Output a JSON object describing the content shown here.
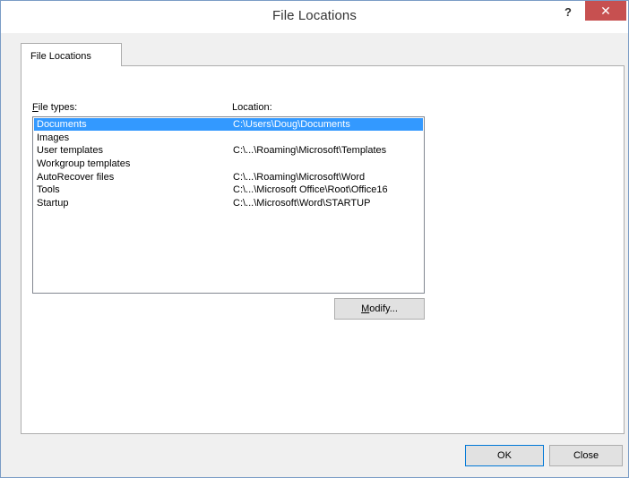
{
  "window": {
    "title": "File Locations",
    "help_glyph": "?",
    "close_glyph": "✕"
  },
  "tab": {
    "label": "File Locations"
  },
  "columns": {
    "file_types_prefix": "F",
    "file_types_rest": "ile types:",
    "location": "Location:"
  },
  "items": [
    {
      "type": "Documents",
      "location": "C:\\Users\\Doug\\Documents",
      "selected": true
    },
    {
      "type": "Images",
      "location": ""
    },
    {
      "type": "User templates",
      "location": "C:\\...\\Roaming\\Microsoft\\Templates"
    },
    {
      "type": "Workgroup templates",
      "location": ""
    },
    {
      "type": "AutoRecover files",
      "location": "C:\\...\\Roaming\\Microsoft\\Word"
    },
    {
      "type": "Tools",
      "location": "C:\\...\\Microsoft Office\\Root\\Office16"
    },
    {
      "type": "Startup",
      "location": "C:\\...\\Microsoft\\Word\\STARTUP"
    }
  ],
  "buttons": {
    "modify_prefix": "M",
    "modify_rest": "odify...",
    "ok": "OK",
    "close": "Close"
  },
  "colors": {
    "selection": "#3399ff",
    "close_button": "#c75050",
    "default_button_border": "#0078d7"
  }
}
